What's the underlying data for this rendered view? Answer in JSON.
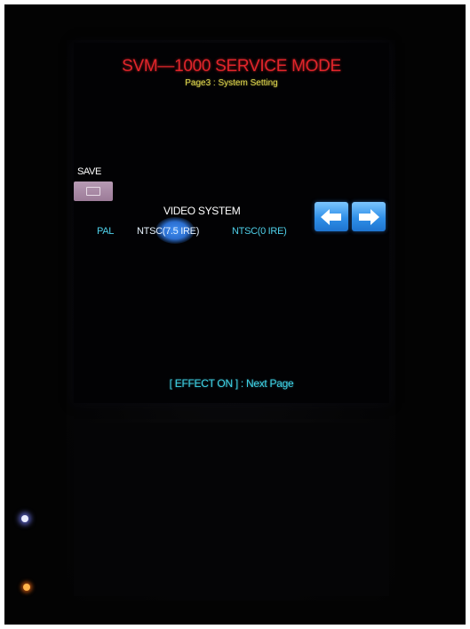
{
  "screen": {
    "title": "SVM—1000 SERVICE MODE",
    "subtitle": "Page3 : System Setting",
    "save_label": "SAVE",
    "video_system": {
      "heading": "VIDEO SYSTEM",
      "options": [
        "PAL",
        "NTSC(7.5 IRE)",
        "NTSC(0 IRE)"
      ],
      "selected": "NTSC(7.5 IRE)"
    },
    "nav": {
      "prev_icon": "arrow-left-icon",
      "next_icon": "arrow-right-icon"
    },
    "footer": "[ EFFECT ON ] : Next Page"
  },
  "colors": {
    "title": "#e0252b",
    "subtitle": "#e2d94f",
    "option_text": "#4fd0ea",
    "selection_highlight": "#3f8ef2",
    "nav_button": "#2f8fe8",
    "footer": "#3fd3e6",
    "led_blue": "#9aa2ff",
    "led_orange": "#ff8a2a"
  }
}
